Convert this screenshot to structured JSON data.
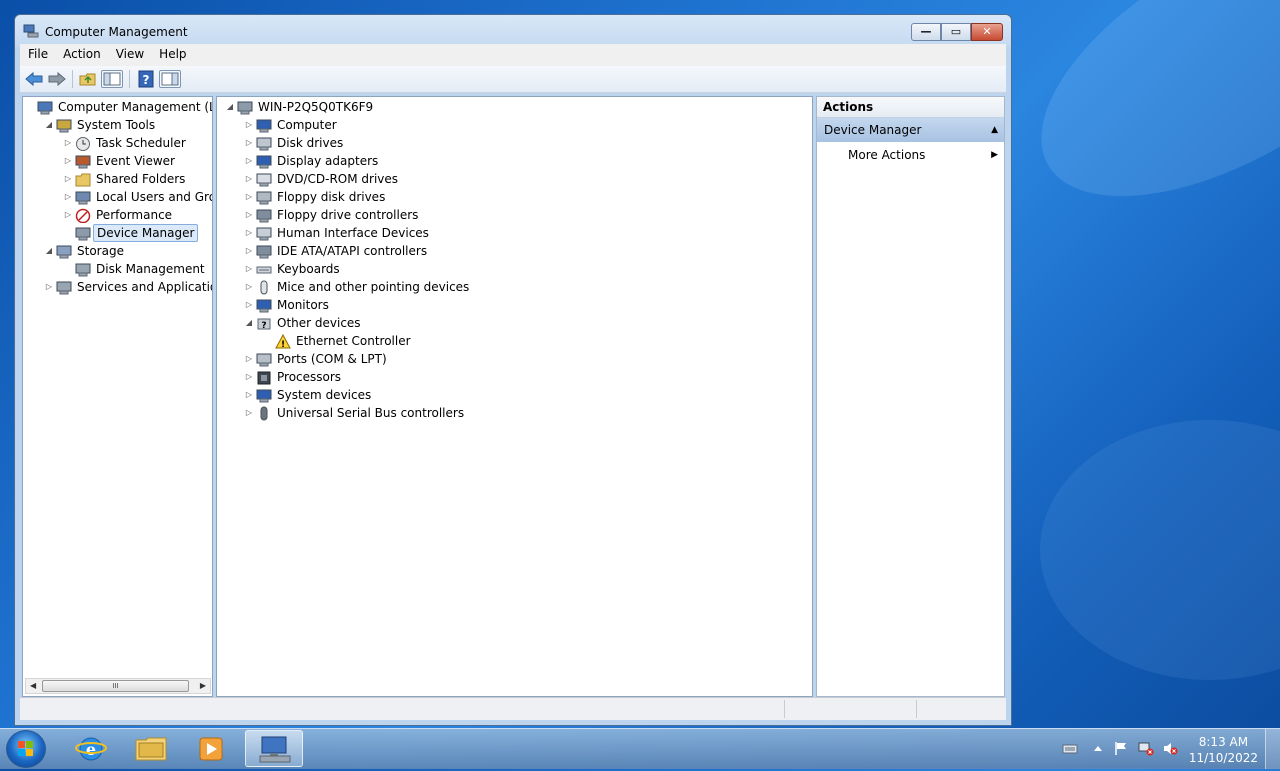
{
  "window": {
    "title": "Computer Management",
    "minimize_glyph": "—",
    "maximize_glyph": "▭",
    "close_glyph": "✕"
  },
  "menu": [
    "File",
    "Action",
    "View",
    "Help"
  ],
  "left_tree": [
    {
      "label": "Computer Management (Local",
      "level": 0,
      "expander": "",
      "icon": "computer-management-icon"
    },
    {
      "label": "System Tools",
      "level": 1,
      "expander": "◢",
      "icon": "system-tools-icon"
    },
    {
      "label": "Task Scheduler",
      "level": 2,
      "expander": "▷",
      "icon": "clock-icon"
    },
    {
      "label": "Event Viewer",
      "level": 2,
      "expander": "▷",
      "icon": "event-viewer-icon"
    },
    {
      "label": "Shared Folders",
      "level": 2,
      "expander": "▷",
      "icon": "shared-folder-icon"
    },
    {
      "label": "Local Users and Groups",
      "level": 2,
      "expander": "▷",
      "icon": "users-icon"
    },
    {
      "label": "Performance",
      "level": 2,
      "expander": "▷",
      "icon": "performance-icon"
    },
    {
      "label": "Device Manager",
      "level": 2,
      "expander": "",
      "icon": "device-manager-icon",
      "selected": true
    },
    {
      "label": "Storage",
      "level": 1,
      "expander": "◢",
      "icon": "storage-icon"
    },
    {
      "label": "Disk Management",
      "level": 2,
      "expander": "",
      "icon": "disk-icon"
    },
    {
      "label": "Services and Applications",
      "level": 1,
      "expander": "▷",
      "icon": "services-icon"
    }
  ],
  "scrollbar": {
    "left": "◀",
    "right": "▶",
    "grip": "III"
  },
  "device_tree": [
    {
      "label": "WIN-P2Q5Q0TK6F9",
      "level": 0,
      "expander": "◢",
      "icon": "computer-icon"
    },
    {
      "label": "Computer",
      "level": 1,
      "expander": "▷",
      "icon": "monitor-icon"
    },
    {
      "label": "Disk drives",
      "level": 1,
      "expander": "▷",
      "icon": "disk-drive-icon"
    },
    {
      "label": "Display adapters",
      "level": 1,
      "expander": "▷",
      "icon": "display-adapter-icon"
    },
    {
      "label": "DVD/CD-ROM drives",
      "level": 1,
      "expander": "▷",
      "icon": "dvd-icon"
    },
    {
      "label": "Floppy disk drives",
      "level": 1,
      "expander": "▷",
      "icon": "floppy-icon"
    },
    {
      "label": "Floppy drive controllers",
      "level": 1,
      "expander": "▷",
      "icon": "controller-icon"
    },
    {
      "label": "Human Interface Devices",
      "level": 1,
      "expander": "▷",
      "icon": "hid-icon"
    },
    {
      "label": "IDE ATA/ATAPI controllers",
      "level": 1,
      "expander": "▷",
      "icon": "ide-icon"
    },
    {
      "label": "Keyboards",
      "level": 1,
      "expander": "▷",
      "icon": "keyboard-icon"
    },
    {
      "label": "Mice and other pointing devices",
      "level": 1,
      "expander": "▷",
      "icon": "mouse-icon"
    },
    {
      "label": "Monitors",
      "level": 1,
      "expander": "▷",
      "icon": "monitor-icon"
    },
    {
      "label": "Other devices",
      "level": 1,
      "expander": "◢",
      "icon": "unknown-device-icon"
    },
    {
      "label": "Ethernet Controller",
      "level": 2,
      "expander": "",
      "icon": "warning-device-icon"
    },
    {
      "label": "Ports (COM & LPT)",
      "level": 1,
      "expander": "▷",
      "icon": "port-icon"
    },
    {
      "label": "Processors",
      "level": 1,
      "expander": "▷",
      "icon": "processor-icon"
    },
    {
      "label": "System devices",
      "level": 1,
      "expander": "▷",
      "icon": "system-device-icon"
    },
    {
      "label": "Universal Serial Bus controllers",
      "level": 1,
      "expander": "▷",
      "icon": "usb-icon"
    }
  ],
  "actions": {
    "header": "Actions",
    "section": "Device Manager",
    "collapse_glyph": "▲",
    "item": "More Actions",
    "arrow_glyph": "▶"
  },
  "taskbar": {
    "time": "8:13 AM",
    "date": "11/10/2022"
  },
  "colors": {
    "selection": "#dbe9f8",
    "actions_section": "#b6cce8",
    "desktop": "#1f73d0"
  }
}
